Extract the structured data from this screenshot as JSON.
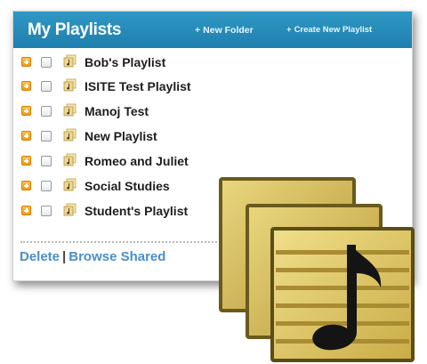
{
  "header": {
    "title": "My Playlists",
    "new_folder": "New Folder",
    "create_playlist": "Create New Playlist",
    "plus": "+"
  },
  "playlists": [
    {
      "label": "Bob's Playlist"
    },
    {
      "label": "ISITE Test Playlist"
    },
    {
      "label": "Manoj Test"
    },
    {
      "label": "New Playlist"
    },
    {
      "label": "Romeo and Juliet"
    },
    {
      "label": "Social Studies"
    },
    {
      "label": "Student's Playlist"
    }
  ],
  "footer": {
    "delete": "Delete",
    "separator": "|",
    "browse_shared": "Browse Shared"
  },
  "colors": {
    "header": "#2389b8",
    "link": "#4a8fc6",
    "expander": "#f39a1a",
    "icon_gold": "#d4bc4e"
  },
  "icons": [
    "expand-plus-icon",
    "playlist-icon",
    "music-note-icon"
  ]
}
